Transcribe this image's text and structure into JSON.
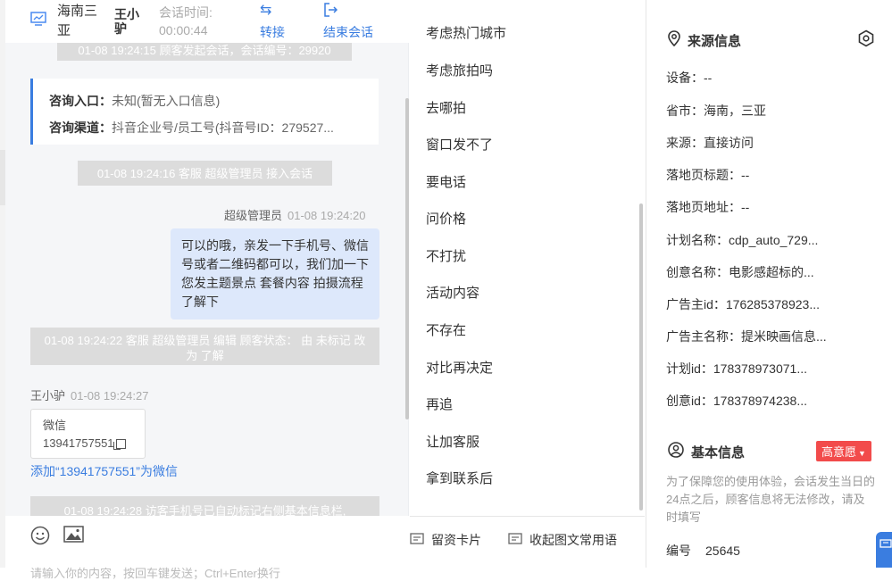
{
  "header": {
    "customer_name": "海南三亚",
    "agent_name": "王小驴",
    "session_time_label": "会话时间:",
    "session_time": "00:00:44",
    "transfer_label": "转接",
    "end_label": "结束会话"
  },
  "messages": {
    "sys1": "01-08 19:24:15 顾客发起会话，会话编号：29920",
    "entry_label": "咨询入口：",
    "entry_value": "未知(暂无入口信息)",
    "channel_label": "咨询渠道：",
    "channel_value": "抖音企业号/员工号(抖音号ID：279527...",
    "sys2": "01-08 19:24:16 客服 超级管理员 接入会话",
    "agent_meta_name": "超级管理员",
    "agent_meta_time": "01-08 19:24:20",
    "agent_bubble": "可以的哦，亲发一下手机号、微信号或者二维码都可以，我们加一下您发主题景点 套餐内容 拍摄流程了解下",
    "sys3": "01-08 19:24:22 客服 超级管理员 编辑 顾客状态： 由 未标记 改为 了解",
    "user_meta_name": "王小驴",
    "user_meta_time": "01-08 19:24:27",
    "card_title": "微信",
    "card_value": "13941757551",
    "add_link": "添加“13941757551”为微信",
    "sys4": "01-08 19:24:28 访客手机号已自动标记右侧基本信息栏,"
  },
  "input": {
    "placeholder": "请输入你的内容，按回车键发送；Ctrl+Enter换行"
  },
  "phrases": {
    "items": [
      "考虑热门城市",
      "考虑旅拍吗",
      "去哪拍",
      "窗口发不了",
      "要电话",
      "问价格",
      "不打扰",
      "活动内容",
      "不存在",
      "对比再决定",
      "再追",
      "让加客服",
      "拿到联系后"
    ],
    "card_button": "留资卡片",
    "collapse_button": "收起图文常用语"
  },
  "source_info": {
    "title": "来源信息",
    "device": "设备：--",
    "province": "省市：海南，三亚",
    "source": "来源：直接访问",
    "landing_title": "落地页标题：--",
    "landing_url": "落地页地址：--",
    "plan_name": "计划名称：cdp_auto_729...",
    "creative_name": "创意名称：电影感超标的...",
    "advertiser_id": "广告主id：176285378923...",
    "advertiser_name": "广告主名称：提米映画信息...",
    "plan_id": "计划id：178378973071...",
    "creative_id": "创意id：178378974238..."
  },
  "basic_info": {
    "title": "基本信息",
    "intent_badge": "高意愿",
    "notice": "为了保障您的使用体验，会话发生当日的24点之后，顾客信息将无法修改，请及时填写",
    "number_label": "编号",
    "number_value": "25645"
  }
}
